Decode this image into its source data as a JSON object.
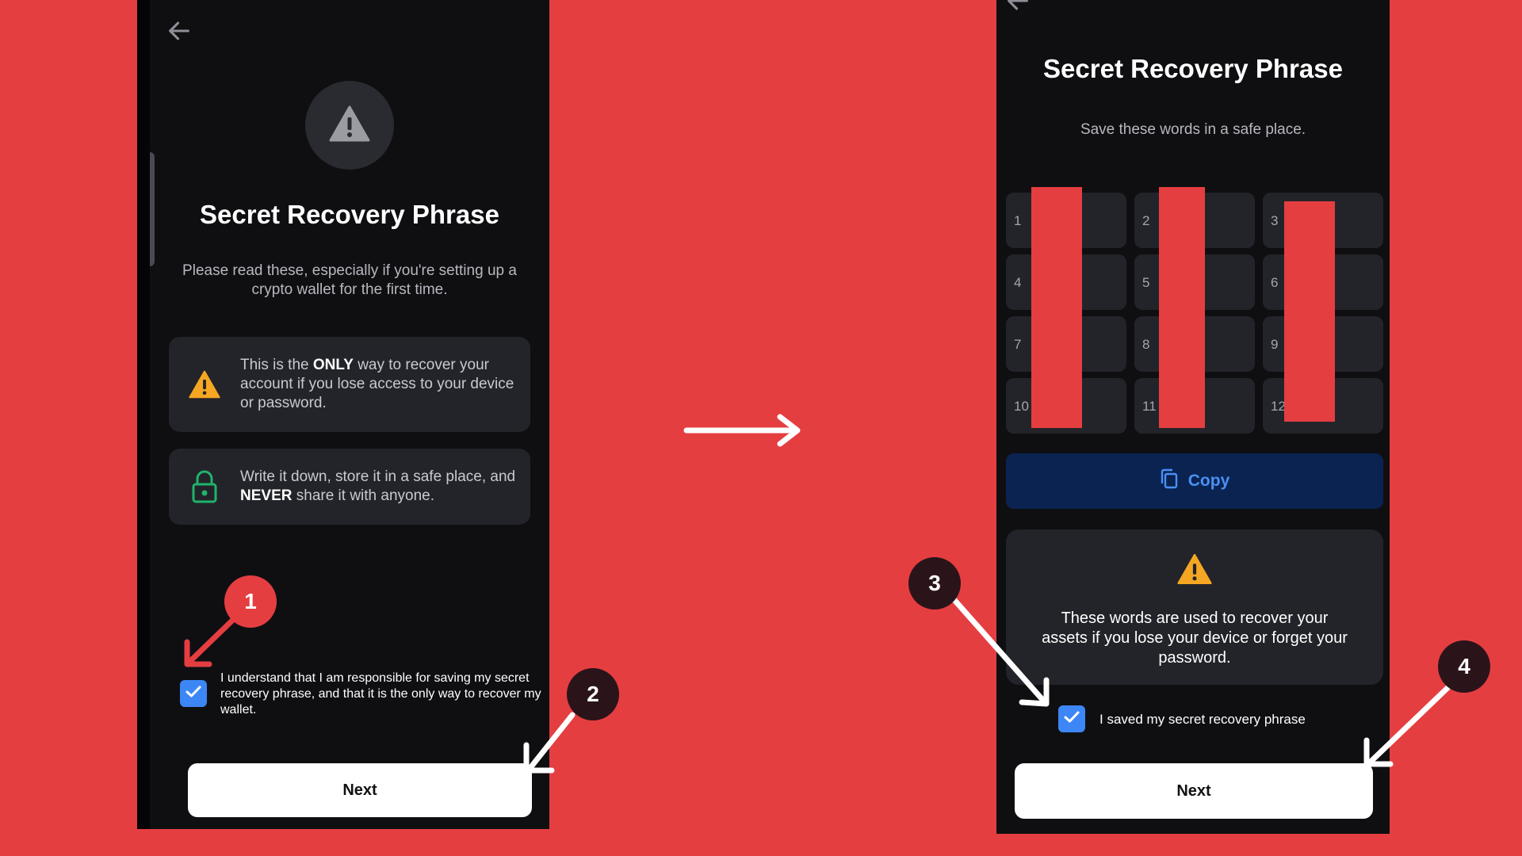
{
  "left_screen": {
    "title": "Secret Recovery Phrase",
    "subtitle": "Please read these, especially if you're setting up a crypto wallet for the first time.",
    "card1": {
      "pre": "This is the ",
      "bold": "ONLY",
      "post": " way to recover your account if you lose access to your device or password."
    },
    "card2": {
      "pre": "Write it down, store it in a safe place, and ",
      "bold": "NEVER",
      "post": " share it with anyone."
    },
    "checkbox_label": "I understand that I am responsible for saving my secret recovery phrase, and that it is the only way to recover my wallet.",
    "next_label": "Next"
  },
  "right_screen": {
    "title": "Secret Recovery Phrase",
    "subtitle": "Save these words in a safe place.",
    "word_numbers": [
      "1",
      "2",
      "3",
      "4",
      "5",
      "6",
      "7",
      "8",
      "9",
      "10",
      "11",
      "12"
    ],
    "copy_label": "Copy",
    "notice": "These words are used to recover your assets if you lose your device or forget your password.",
    "checkbox_label": "I saved my secret recovery phrase",
    "next_label": "Next"
  },
  "annotations": {
    "badge1": "1",
    "badge2": "2",
    "badge3": "3",
    "badge4": "4"
  },
  "colors": {
    "background": "#e53e41",
    "checkbox": "#3d86f5",
    "warning": "#f5a623",
    "lock": "#1fb36b",
    "badge_red": "#e53e41",
    "badge_dark": "#2a141a"
  },
  "icons": [
    "back-arrow-icon",
    "warning-icon",
    "lock-icon",
    "check-icon",
    "copy-icon",
    "arrow-right-icon"
  ]
}
